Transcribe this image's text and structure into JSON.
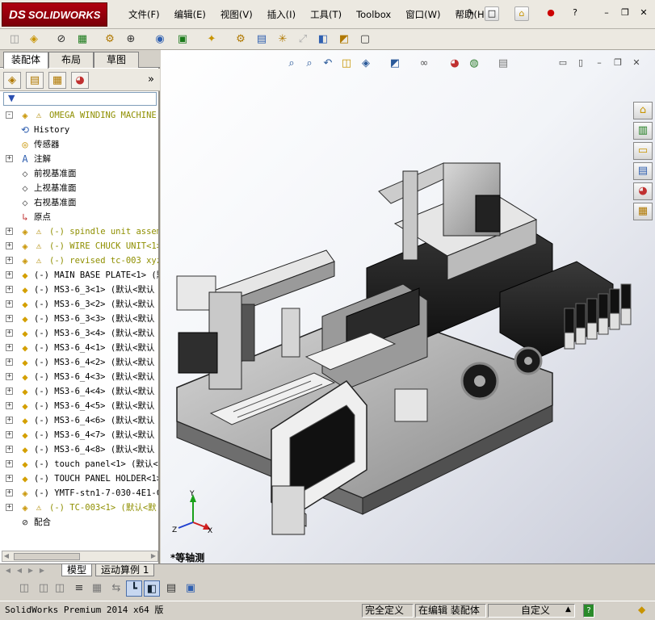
{
  "app": {
    "logo": "SOLIDWORKS",
    "logo_prefix": "DS"
  },
  "menu": [
    "文件(F)",
    "编辑(E)",
    "视图(V)",
    "插入(I)",
    "工具(T)",
    "Toolbox",
    "窗口(W)",
    "帮助(H)"
  ],
  "panel_tabs": [
    "装配体",
    "布局",
    "草图"
  ],
  "filter_icon": "filter-icon",
  "tree": [
    {
      "label": "OMEGA WINDING MACHINE  (默",
      "icon": "assembly-icon",
      "warn": true,
      "olive": true,
      "expander": "-",
      "level": 0
    },
    {
      "label": "History",
      "icon": "history-icon",
      "level": 1
    },
    {
      "label": "传感器",
      "icon": "sensor-icon",
      "level": 1
    },
    {
      "label": "注解",
      "icon": "annotation-icon",
      "expander": "+",
      "level": 1
    },
    {
      "label": "前视基准面",
      "icon": "plane-icon",
      "level": 1
    },
    {
      "label": "上视基准面",
      "icon": "plane-icon",
      "level": 1
    },
    {
      "label": "右视基准面",
      "icon": "plane-icon",
      "level": 1
    },
    {
      "label": "原点",
      "icon": "origin-icon",
      "level": 1
    },
    {
      "label": "(-) spindle unit assemb",
      "icon": "assembly-icon",
      "warn": true,
      "olive": true,
      "expander": "+",
      "level": 1
    },
    {
      "label": "(-) WIRE CHUCK UNIT<1>",
      "icon": "assembly-icon",
      "warn": true,
      "olive": true,
      "expander": "+",
      "level": 1
    },
    {
      "label": "(-) revised tc-003 xyz",
      "icon": "assembly-icon",
      "warn": true,
      "olive": true,
      "expander": "+",
      "level": 1
    },
    {
      "label": "(-) MAIN BASE PLATE<1> (默",
      "icon": "part-icon",
      "expander": "+",
      "level": 1
    },
    {
      "label": "(-) MS3-6_3<1> (默认<默认",
      "icon": "part-icon",
      "expander": "+",
      "level": 1
    },
    {
      "label": "(-) MS3-6_3<2> (默认<默认",
      "icon": "part-icon",
      "expander": "+",
      "level": 1
    },
    {
      "label": "(-) MS3-6_3<3> (默认<默认",
      "icon": "part-icon",
      "expander": "+",
      "level": 1
    },
    {
      "label": "(-) MS3-6_3<4> (默认<默认",
      "icon": "part-icon",
      "expander": "+",
      "level": 1
    },
    {
      "label": "(-) MS3-6_4<1> (默认<默认",
      "icon": "part-icon",
      "expander": "+",
      "level": 1
    },
    {
      "label": "(-) MS3-6_4<2> (默认<默认",
      "icon": "part-icon",
      "expander": "+",
      "level": 1
    },
    {
      "label": "(-) MS3-6_4<3> (默认<默认",
      "icon": "part-icon",
      "expander": "+",
      "level": 1
    },
    {
      "label": "(-) MS3-6_4<4> (默认<默认",
      "icon": "part-icon",
      "expander": "+",
      "level": 1
    },
    {
      "label": "(-) MS3-6_4<5> (默认<默认",
      "icon": "part-icon",
      "expander": "+",
      "level": 1
    },
    {
      "label": "(-) MS3-6_4<6> (默认<默认",
      "icon": "part-icon",
      "expander": "+",
      "level": 1
    },
    {
      "label": "(-) MS3-6_4<7> (默认<默认",
      "icon": "part-icon",
      "expander": "+",
      "level": 1
    },
    {
      "label": "(-) MS3-6_4<8> (默认<默认",
      "icon": "part-icon",
      "expander": "+",
      "level": 1
    },
    {
      "label": "(-) touch panel<1> (默认<",
      "icon": "part-icon",
      "expander": "+",
      "level": 1
    },
    {
      "label": "(-) TOUCH PANEL HOLDER<1>",
      "icon": "part-icon",
      "expander": "+",
      "level": 1
    },
    {
      "label": "(-) YMTF-stn1-7-030-4E1-C",
      "icon": "assembly-icon",
      "expander": "+",
      "level": 1
    },
    {
      "label": "(-) TC-003<1> (默认<默",
      "icon": "assembly-icon",
      "warn": true,
      "olive": true,
      "expander": "+",
      "level": 1
    },
    {
      "label": "配合",
      "icon": "mate-icon",
      "level": 1
    }
  ],
  "view_name": "*等轴测",
  "triad": {
    "x": "X",
    "y": "Y",
    "z": "Z"
  },
  "bottom_tabs": [
    "模型",
    "运动算例 1"
  ],
  "status": {
    "version": "SolidWorks Premium 2014 x64 版",
    "definition": "完全定义",
    "editing": "在编辑 装配体",
    "units": "自定义",
    "help": "?"
  },
  "colors": {
    "logo_red": "#a8000e",
    "warning_yellow": "#f2d600",
    "tree_olive": "#8f8f00"
  }
}
